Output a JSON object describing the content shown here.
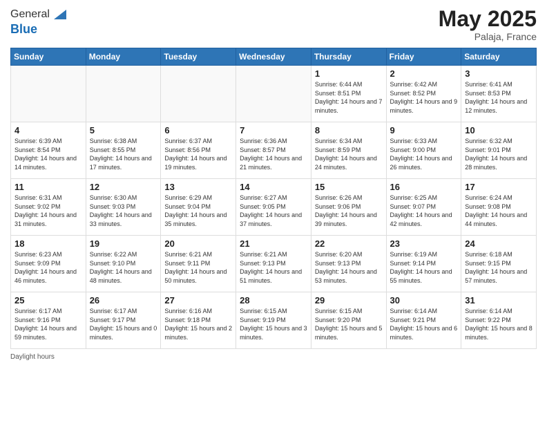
{
  "logo": {
    "line1": "General",
    "line2": "Blue"
  },
  "header": {
    "month": "May 2025",
    "location": "Palaja, France"
  },
  "days_of_week": [
    "Sunday",
    "Monday",
    "Tuesday",
    "Wednesday",
    "Thursday",
    "Friday",
    "Saturday"
  ],
  "weeks": [
    [
      {
        "day": "",
        "info": ""
      },
      {
        "day": "",
        "info": ""
      },
      {
        "day": "",
        "info": ""
      },
      {
        "day": "",
        "info": ""
      },
      {
        "day": "1",
        "info": "Sunrise: 6:44 AM\nSunset: 8:51 PM\nDaylight: 14 hours and 7 minutes."
      },
      {
        "day": "2",
        "info": "Sunrise: 6:42 AM\nSunset: 8:52 PM\nDaylight: 14 hours and 9 minutes."
      },
      {
        "day": "3",
        "info": "Sunrise: 6:41 AM\nSunset: 8:53 PM\nDaylight: 14 hours and 12 minutes."
      }
    ],
    [
      {
        "day": "4",
        "info": "Sunrise: 6:39 AM\nSunset: 8:54 PM\nDaylight: 14 hours and 14 minutes."
      },
      {
        "day": "5",
        "info": "Sunrise: 6:38 AM\nSunset: 8:55 PM\nDaylight: 14 hours and 17 minutes."
      },
      {
        "day": "6",
        "info": "Sunrise: 6:37 AM\nSunset: 8:56 PM\nDaylight: 14 hours and 19 minutes."
      },
      {
        "day": "7",
        "info": "Sunrise: 6:36 AM\nSunset: 8:57 PM\nDaylight: 14 hours and 21 minutes."
      },
      {
        "day": "8",
        "info": "Sunrise: 6:34 AM\nSunset: 8:59 PM\nDaylight: 14 hours and 24 minutes."
      },
      {
        "day": "9",
        "info": "Sunrise: 6:33 AM\nSunset: 9:00 PM\nDaylight: 14 hours and 26 minutes."
      },
      {
        "day": "10",
        "info": "Sunrise: 6:32 AM\nSunset: 9:01 PM\nDaylight: 14 hours and 28 minutes."
      }
    ],
    [
      {
        "day": "11",
        "info": "Sunrise: 6:31 AM\nSunset: 9:02 PM\nDaylight: 14 hours and 31 minutes."
      },
      {
        "day": "12",
        "info": "Sunrise: 6:30 AM\nSunset: 9:03 PM\nDaylight: 14 hours and 33 minutes."
      },
      {
        "day": "13",
        "info": "Sunrise: 6:29 AM\nSunset: 9:04 PM\nDaylight: 14 hours and 35 minutes."
      },
      {
        "day": "14",
        "info": "Sunrise: 6:27 AM\nSunset: 9:05 PM\nDaylight: 14 hours and 37 minutes."
      },
      {
        "day": "15",
        "info": "Sunrise: 6:26 AM\nSunset: 9:06 PM\nDaylight: 14 hours and 39 minutes."
      },
      {
        "day": "16",
        "info": "Sunrise: 6:25 AM\nSunset: 9:07 PM\nDaylight: 14 hours and 42 minutes."
      },
      {
        "day": "17",
        "info": "Sunrise: 6:24 AM\nSunset: 9:08 PM\nDaylight: 14 hours and 44 minutes."
      }
    ],
    [
      {
        "day": "18",
        "info": "Sunrise: 6:23 AM\nSunset: 9:09 PM\nDaylight: 14 hours and 46 minutes."
      },
      {
        "day": "19",
        "info": "Sunrise: 6:22 AM\nSunset: 9:10 PM\nDaylight: 14 hours and 48 minutes."
      },
      {
        "day": "20",
        "info": "Sunrise: 6:21 AM\nSunset: 9:11 PM\nDaylight: 14 hours and 50 minutes."
      },
      {
        "day": "21",
        "info": "Sunrise: 6:21 AM\nSunset: 9:13 PM\nDaylight: 14 hours and 51 minutes."
      },
      {
        "day": "22",
        "info": "Sunrise: 6:20 AM\nSunset: 9:13 PM\nDaylight: 14 hours and 53 minutes."
      },
      {
        "day": "23",
        "info": "Sunrise: 6:19 AM\nSunset: 9:14 PM\nDaylight: 14 hours and 55 minutes."
      },
      {
        "day": "24",
        "info": "Sunrise: 6:18 AM\nSunset: 9:15 PM\nDaylight: 14 hours and 57 minutes."
      }
    ],
    [
      {
        "day": "25",
        "info": "Sunrise: 6:17 AM\nSunset: 9:16 PM\nDaylight: 14 hours and 59 minutes."
      },
      {
        "day": "26",
        "info": "Sunrise: 6:17 AM\nSunset: 9:17 PM\nDaylight: 15 hours and 0 minutes."
      },
      {
        "day": "27",
        "info": "Sunrise: 6:16 AM\nSunset: 9:18 PM\nDaylight: 15 hours and 2 minutes."
      },
      {
        "day": "28",
        "info": "Sunrise: 6:15 AM\nSunset: 9:19 PM\nDaylight: 15 hours and 3 minutes."
      },
      {
        "day": "29",
        "info": "Sunrise: 6:15 AM\nSunset: 9:20 PM\nDaylight: 15 hours and 5 minutes."
      },
      {
        "day": "30",
        "info": "Sunrise: 6:14 AM\nSunset: 9:21 PM\nDaylight: 15 hours and 6 minutes."
      },
      {
        "day": "31",
        "info": "Sunrise: 6:14 AM\nSunset: 9:22 PM\nDaylight: 15 hours and 8 minutes."
      }
    ]
  ],
  "footer": {
    "text": "Daylight hours"
  }
}
